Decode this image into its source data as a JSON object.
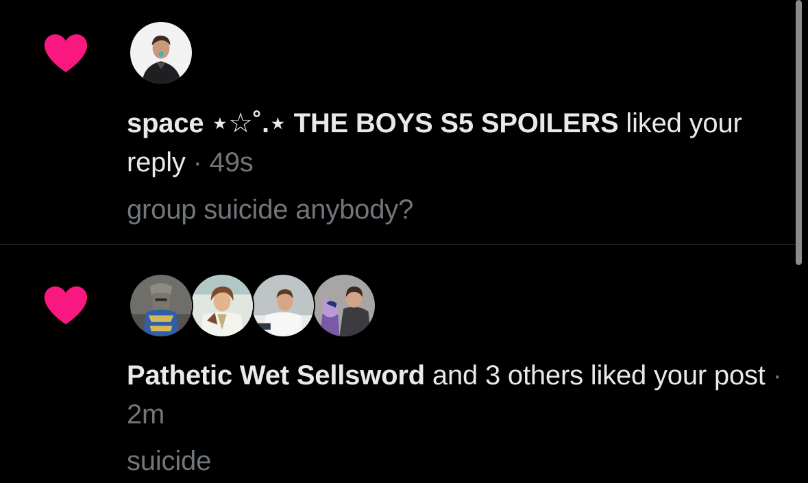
{
  "colors": {
    "background": "#000000",
    "heart": "#f91880",
    "text": "#e7e9ea",
    "muted": "#71767b",
    "divider": "#2f3336"
  },
  "notifications": [
    {
      "icon": "heart-icon",
      "name": "space ⋆☆˚.⋆ THE BOYS S5 SPOILERS",
      "action": " liked your reply",
      "separator": " · ",
      "time": "49s",
      "snippet": "group suicide anybody?"
    },
    {
      "icon": "heart-icon",
      "name": "Pathetic Wet Sellsword",
      "action": " and 3 others liked your post",
      "separator": " · ",
      "time": "2m",
      "snippet": "suicide"
    }
  ]
}
